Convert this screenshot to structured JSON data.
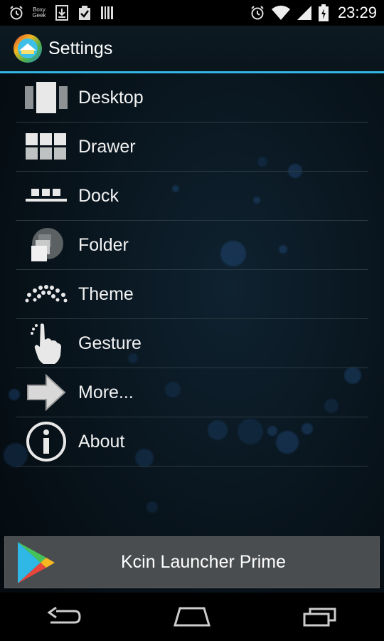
{
  "status_bar": {
    "time": "23:29",
    "notification_icons": [
      "alarm-icon",
      "boxy-geek-icon",
      "download-icon",
      "clipboard-check-icon",
      "barcode-icon"
    ],
    "boxy_geek_line1": "Boxy",
    "boxy_geek_line2": "Geek",
    "system_icons": [
      "alarm-icon",
      "wifi-icon",
      "signal-icon",
      "battery-charging-icon"
    ]
  },
  "action_bar": {
    "title": "Settings",
    "icon": "launcher-logo-icon"
  },
  "menu": {
    "items": [
      {
        "label": "Desktop",
        "icon": "desktop-icon"
      },
      {
        "label": "Drawer",
        "icon": "drawer-icon"
      },
      {
        "label": "Dock",
        "icon": "dock-icon"
      },
      {
        "label": "Folder",
        "icon": "folder-icon"
      },
      {
        "label": "Theme",
        "icon": "theme-icon"
      },
      {
        "label": "Gesture",
        "icon": "gesture-icon"
      },
      {
        "label": "More...",
        "icon": "arrow-right-icon"
      },
      {
        "label": "About",
        "icon": "info-icon"
      }
    ]
  },
  "promo": {
    "label": "Kcin Launcher Prime",
    "icon": "play-store-icon"
  },
  "nav_bar": {
    "buttons": [
      "back-icon",
      "home-icon",
      "recents-icon"
    ]
  },
  "colors": {
    "accent": "#33b5e5",
    "background": "#0a1117",
    "promo_bg": "#4a4d4f"
  }
}
